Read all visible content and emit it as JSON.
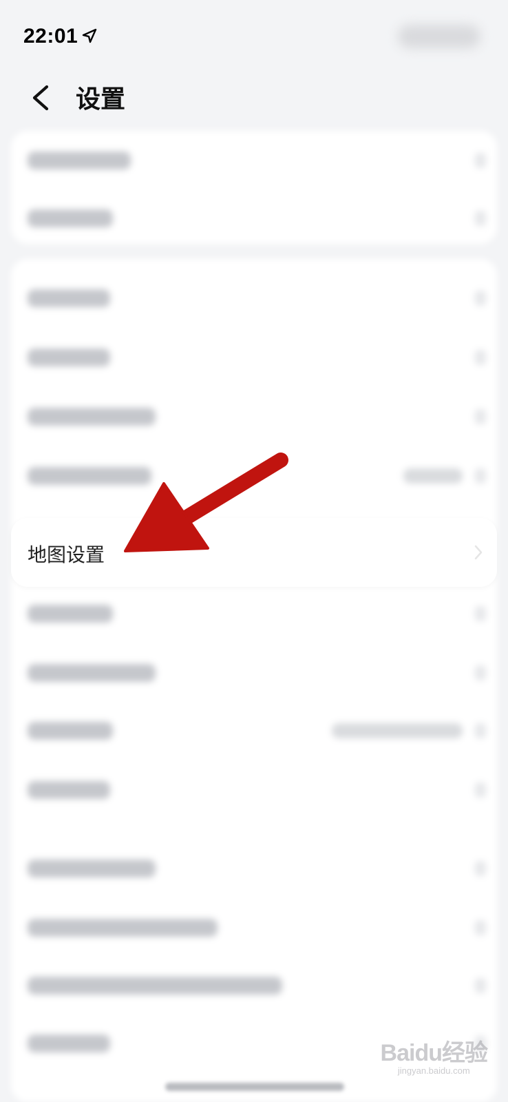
{
  "status_bar": {
    "time": "22:01",
    "location_icon": "location-arrow-icon"
  },
  "nav": {
    "back_icon": "chevron-left-icon",
    "title": "设置"
  },
  "highlighted_item": {
    "label": "地图设置",
    "chevron_icon": "chevron-right-icon"
  },
  "annotation": {
    "arrow_color": "#c0140f"
  },
  "watermark": {
    "logo": "Baidu经验",
    "url": "jingyan.baidu.com"
  },
  "colors": {
    "background": "#f3f4f6",
    "card": "#ffffff",
    "title": "#111111"
  }
}
